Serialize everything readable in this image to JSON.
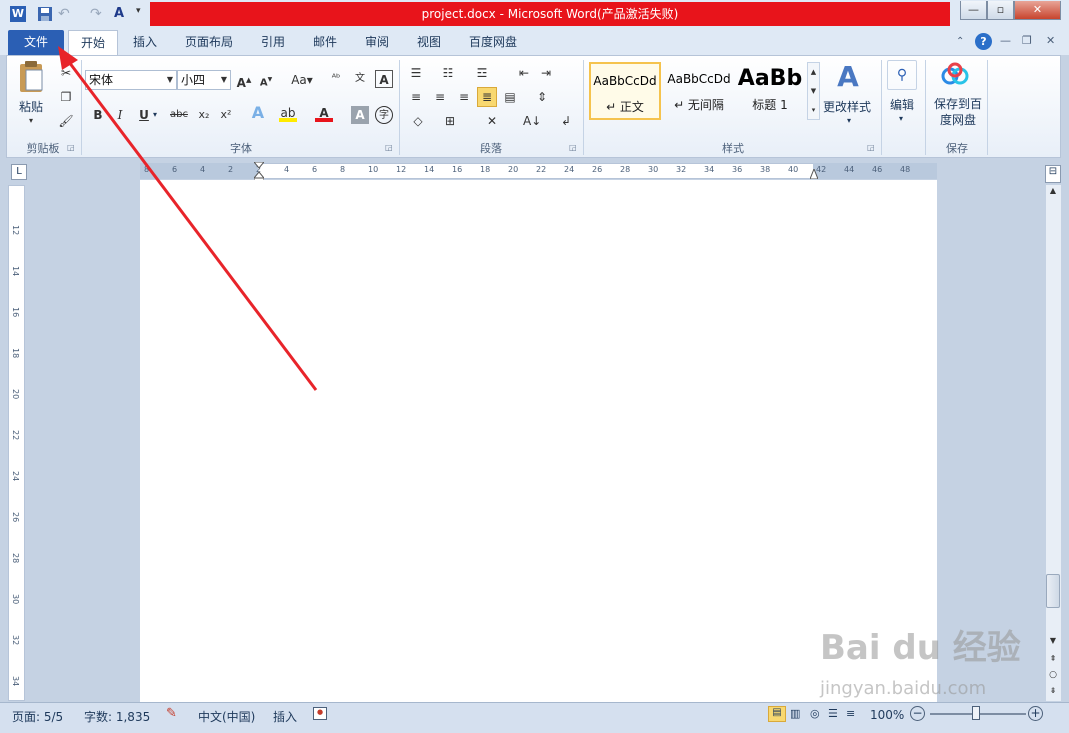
{
  "title": "project.docx - Microsoft Word(产品激活失败)",
  "tabs": {
    "file": "文件",
    "home": "开始",
    "insert": "插入",
    "layout": "页面布局",
    "references": "引用",
    "mailings": "邮件",
    "review": "审阅",
    "view": "视图",
    "baidu": "百度网盘"
  },
  "clipboard": {
    "paste": "粘贴",
    "label": "剪贴板"
  },
  "font": {
    "name": "宋体",
    "size": "小四",
    "label": "字体"
  },
  "paragraph": {
    "label": "段落"
  },
  "styles": {
    "label": "样式",
    "items": [
      {
        "sample": "AaBbCcDd",
        "name": "↵ 正文"
      },
      {
        "sample": "AaBbCcDd",
        "name": "↵ 无间隔"
      },
      {
        "sample": "AaBb",
        "name": "标题 1"
      }
    ],
    "change": "更改样式"
  },
  "editing": {
    "label": "编辑"
  },
  "save": {
    "button": "保存到百度网盘",
    "line1": "保存到百",
    "line2": "度网盘",
    "label": "保存"
  },
  "ruler": {
    "h_ticks": [
      "8",
      "6",
      "4",
      "2",
      "2",
      "4",
      "6",
      "8",
      "10",
      "12",
      "14",
      "16",
      "18",
      "20",
      "22",
      "24",
      "26",
      "28",
      "30",
      "32",
      "34",
      "36",
      "38",
      "40",
      "42",
      "44",
      "46",
      "48"
    ],
    "v_ticks": [
      "12",
      "14",
      "16",
      "18",
      "20",
      "22",
      "24",
      "26",
      "28",
      "30",
      "32",
      "34"
    ]
  },
  "status": {
    "page": "页面: 5/5",
    "words": "字数: 1,835",
    "language": "中文(中国)",
    "mode": "插入",
    "zoom": "100%"
  },
  "watermark": {
    "main": "Bai du 经验",
    "sub": "jingyan.baidu.com"
  },
  "colors": {
    "title_bar": "#e8141b",
    "file_tab": "#2b5fb4",
    "arrow": "#e8242a"
  }
}
